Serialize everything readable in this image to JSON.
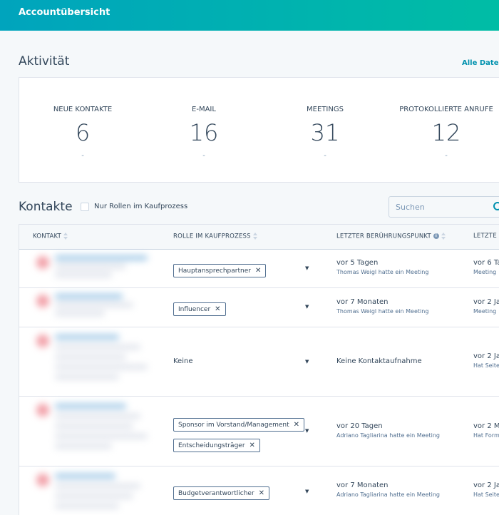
{
  "header": {
    "title": "Accountübersicht"
  },
  "activity": {
    "title": "Aktivität",
    "all_data_link": "Alle Daten",
    "stats": [
      {
        "label": "NEUE KONTAKTE",
        "value": "6",
        "sub": "-"
      },
      {
        "label": "E-MAIL",
        "value": "16",
        "sub": "-"
      },
      {
        "label": "MEETINGS",
        "value": "31",
        "sub": "-"
      },
      {
        "label": "PROTOKOLLIERTE ANRUFE",
        "value": "12",
        "sub": "-"
      }
    ]
  },
  "contacts": {
    "title": "Kontakte",
    "filter_label": "Nur Rollen im Kaufprozess",
    "search_placeholder": "Suchen",
    "columns": {
      "contact": "KONTAKT",
      "role": "ROLLE IM KAUFPROZESS",
      "last_touch": "LETZTER BERÜHRUNGSPUNKT",
      "last_activity": "LETZTE I"
    },
    "rows": [
      {
        "roles": [
          "Hauptansprechpartner"
        ],
        "touch_main": "vor 5 Tagen",
        "touch_sub": "Thomas Weigl hatte ein Meeting",
        "last_main": "vor 6 Ta",
        "last_sub": "Meeting"
      },
      {
        "roles": [
          "Influencer"
        ],
        "touch_main": "vor 7 Monaten",
        "touch_sub": "Thomas Weigl hatte ein Meeting",
        "last_main": "vor 2 Ja",
        "last_sub": "Meeting"
      },
      {
        "role_none": "Keine",
        "touch_main": "Keine Kontaktaufnahme",
        "touch_sub": "",
        "last_main": "vor 2 Ja",
        "last_sub": "Hat Seite"
      },
      {
        "roles": [
          "Sponsor im Vorstand/Management",
          "Entscheidungsträger"
        ],
        "touch_main": "vor 20 Tagen",
        "touch_sub": "Adriano Tagliarina hatte ein Meeting",
        "last_main": "vor 2 M",
        "last_sub": "Hat Form"
      },
      {
        "roles": [
          "Budgetverantwortlicher"
        ],
        "touch_main": "vor 7 Monaten",
        "touch_sub": "Adriano Tagliarina hatte ein Meeting",
        "last_main": "vor 2 Ja",
        "last_sub": "Hat Seite"
      }
    ]
  },
  "colors": {
    "header_start": "#00a4bd",
    "header_end": "#00bda5",
    "link": "#0091ae"
  },
  "icons": {
    "search": "search-icon",
    "sort": "sort-icon",
    "info": "info-icon",
    "remove": "close-icon",
    "dropdown": "caret-down-icon"
  }
}
